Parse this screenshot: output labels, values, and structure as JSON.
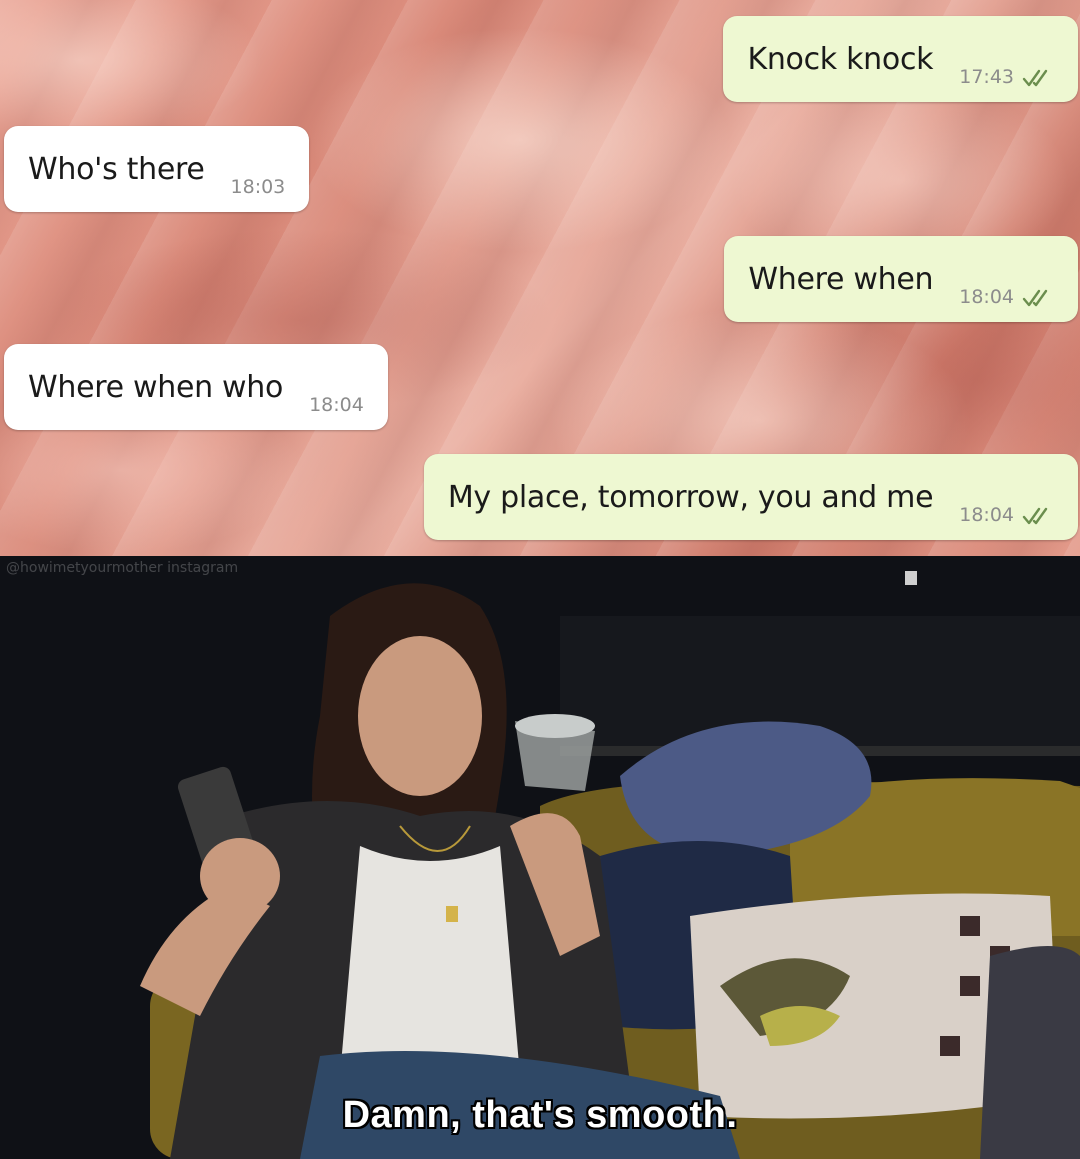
{
  "chat": {
    "messages": [
      {
        "direction": "out",
        "text": "Knock knock",
        "time": "17:43",
        "status": "read"
      },
      {
        "direction": "in",
        "text": "Who's there",
        "time": "18:03"
      },
      {
        "direction": "out",
        "text": "Where when",
        "time": "18:04",
        "status": "read"
      },
      {
        "direction": "in",
        "text": "Where when who",
        "time": "18:04"
      },
      {
        "direction": "out",
        "text": "My place, tomorrow, you and me",
        "time": "18:04",
        "status": "read"
      }
    ],
    "colors": {
      "incoming_bubble": "#ffffff",
      "outgoing_bubble": "#eef8d2",
      "timestamp": "#8c8c8c",
      "read_tick": "#6b8e4e"
    }
  },
  "scene": {
    "watermark": "@howimetyourmother instagram",
    "subtitle": "Damn, that's smooth."
  },
  "icons": {
    "double_tick": "double-check-icon"
  }
}
